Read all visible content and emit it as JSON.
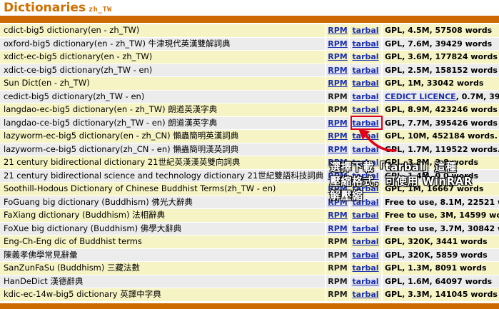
{
  "header": {
    "title": "Dictionaries",
    "lang": "zh_TW"
  },
  "rows": [
    {
      "name": "cdict-big5 dictionary(en - zh_TW)",
      "rpm": "RPM",
      "rpm_link": true,
      "tarbal": "tarbal",
      "tarbal_link": true,
      "license": "GPL, 4.5M, 57508 words"
    },
    {
      "name": "oxford-big5 dictionary(en - zh_TW) 牛津現代英漢雙解詞典",
      "rpm": "RPM",
      "rpm_link": true,
      "tarbal": "tarbal",
      "tarbal_link": true,
      "license": "GPL, 7.6M, 39429 words"
    },
    {
      "name": "xdict-ec-big5 dictionary(en - zh_TW)",
      "rpm": "RPM",
      "rpm_link": true,
      "tarbal": "tarbal",
      "tarbal_link": true,
      "license": "GPL, 3.6M, 177824 words"
    },
    {
      "name": "xdict-ce-big5 dictionary(zh_TW - en)",
      "rpm": "RPM",
      "rpm_link": true,
      "tarbal": "tarbal",
      "tarbal_link": true,
      "license": "GPL, 2.5M, 158152 words"
    },
    {
      "name": "Sun Dict(en - zh_TW)",
      "rpm": "RPM",
      "rpm_link": true,
      "tarbal": "tarbal",
      "tarbal_link": true,
      "license": "GPL, 1M, 33042 words"
    },
    {
      "name": "cedict-big5 dictionary(zh_TW - en)",
      "rpm": "RPM",
      "rpm_link": false,
      "tarbal": "tarbal",
      "tarbal_link": true,
      "license": "CEDICT LICENCE, 0.7M, 39",
      "license_link_text": "CEDICT LICENCE"
    },
    {
      "name": "langdao-ec-big5 dictionary(en - zh_TW) 朗道英漢字典",
      "rpm": "RPM",
      "rpm_link": false,
      "tarbal": "tarbal",
      "tarbal_link": true,
      "license": "GPL, 8.9M, 423246 words"
    },
    {
      "name": "langdao-ce-big5 dictionary(zh_TW - en) 朗道漢英字典",
      "rpm": "RPM",
      "rpm_link": true,
      "tarbal": "tarbal",
      "tarbal_link": true,
      "license": "GPL, 7.7M, 395426 words"
    },
    {
      "name": "lazyworm-ec-big5 dictionary(en - zh_CN) 懶蟲簡明英漢詞典",
      "rpm": "RPM",
      "rpm_link": true,
      "tarbal": "tarbal",
      "tarbal_link": true,
      "license": "GPL, 10M, 452184 words."
    },
    {
      "name": "lazyworm-ce-big5 dictionary(zh_CN - en) 懶蟲簡明漢英詞典",
      "rpm": "RPM",
      "rpm_link": true,
      "tarbal": "tarbal",
      "tarbal_link": true,
      "license": "GPL, 1.7M, 119522 words."
    },
    {
      "name": "21 century bidirectional dictionary 21世紀英漢漢英雙向詞典",
      "rpm": "RPM",
      "rpm_link": true,
      "tarbal": "tarbal",
      "tarbal_link": true,
      "license": "GPL, 3.8M, 2         8 words"
    },
    {
      "name": "21 century bidirectional science and technology dictionary 21世紀雙語科技詞典",
      "rpm": "RPM",
      "rpm_link": true,
      "tarbal": "tarbal",
      "tarbal_link": true,
      "license": "GPL, 1.4M, 0    0 words"
    },
    {
      "name": "Soothill-Hodous Dictionary of Chinese Buddhist Terms(zh_TW - en)",
      "rpm": "RPM",
      "rpm_link": true,
      "tarbal": "tarbal",
      "tarbal_link": true,
      "license": "GPL, 1M, 16667 words"
    },
    {
      "name": "FoGuang big dictionary (Buddhism) 佛光大辭典",
      "rpm": "RPM",
      "rpm_link": true,
      "tarbal": "tarbal",
      "tarbal_link": true,
      "license": "Free to use, 8.1M, 22521 w"
    },
    {
      "name": "FaXiang dictionary (Buddhism) 法相辭典",
      "rpm": "RPM",
      "rpm_link": true,
      "tarbal": "tarbal",
      "tarbal_link": true,
      "license": "Free to use, 3M, 14599 wor"
    },
    {
      "name": "FoXue big dictionary (Buddhism) 佛學大辭典",
      "rpm": "RPM",
      "rpm_link": true,
      "tarbal": "tarbal",
      "tarbal_link": true,
      "license": "Free to use, 3.7M, 30842 w"
    },
    {
      "name": "Eng-Ch-Eng dic of Buddhist terms",
      "rpm": "RPM",
      "rpm_link": false,
      "tarbal": "tarbal",
      "tarbal_link": true,
      "license": "GPL, 320K, 3441 words"
    },
    {
      "name": "陳義孝佛學常見辭彙",
      "rpm": "RPM",
      "rpm_link": false,
      "tarbal": "tarbal",
      "tarbal_link": true,
      "license": "GPL, 320K, 5859 words"
    },
    {
      "name": "SanZunFaSu (Buddhism) 三藏法數",
      "rpm": "RPM",
      "rpm_link": false,
      "tarbal": "tarbal",
      "tarbal_link": true,
      "license": "GPL, 1.3M, 8091 words"
    },
    {
      "name": "HanDeDict 漢德辭典",
      "rpm": "RPM",
      "rpm_link": false,
      "tarbal": "tarbal",
      "tarbal_link": true,
      "license": "GPL, 1.6M, 64097 words"
    },
    {
      "name": "kdic-ec-14w-big5 dictionary 英譯中字典",
      "rpm": "RPM",
      "rpm_link": false,
      "tarbal": "tarbal",
      "tarbal_link": true,
      "license": "GPL, 3.3M, 141045 words"
    }
  ],
  "annotation": {
    "text": "選擇下載「tarbal」這種\n壓縮格式，可使用 WinRAR\n解壓縮",
    "highlight_color": "#e0001b"
  },
  "colors": {
    "accent": "#cc6a00",
    "title": "#d07000",
    "link": "#1a2fb0",
    "row_odd": "#f6f4c4",
    "row_even": "#ececec"
  }
}
